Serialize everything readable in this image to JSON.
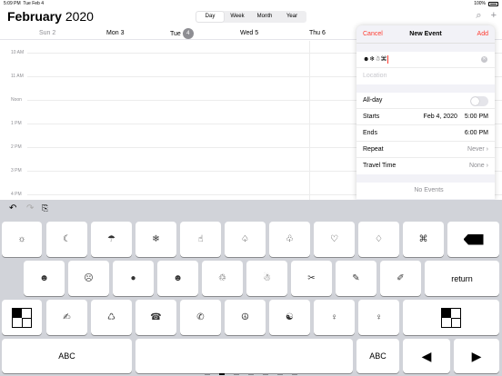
{
  "status": {
    "time": "5:09 PM",
    "date": "Tue Feb 4",
    "battery": "100%"
  },
  "header": {
    "month": "February",
    "year": "2020",
    "views": [
      "Day",
      "Week",
      "Month",
      "Year"
    ],
    "active_view": "Day"
  },
  "days": [
    {
      "name": "Sun",
      "num": "2"
    },
    {
      "name": "Mon",
      "num": "3"
    },
    {
      "name": "Tue",
      "num": "4"
    },
    {
      "name": "Wed",
      "num": "5"
    },
    {
      "name": "Thu",
      "num": "6"
    }
  ],
  "hours": [
    "10 AM",
    "11 AM",
    "Noon",
    "1 PM",
    "2 PM",
    "3 PM",
    "4 PM"
  ],
  "new_event": {
    "cancel": "Cancel",
    "title": "New Event",
    "add": "Add",
    "title_value": "☻❄☃⌘",
    "location_placeholder": "Location",
    "allday_label": "All-day",
    "starts_label": "Starts",
    "starts_date": "Feb 4, 2020",
    "starts_time": "5:00 PM",
    "ends_label": "Ends",
    "ends_time": "6:00 PM",
    "repeat_label": "Repeat",
    "repeat_value": "Never",
    "travel_label": "Travel Time",
    "travel_value": "None",
    "no_events": "No Events"
  },
  "keyboard": {
    "row1": [
      "☼",
      "☾",
      "☂",
      "❄",
      "☝",
      "♤",
      "♧",
      "♡",
      "♢",
      "⌘"
    ],
    "row2": [
      "☻",
      "☹",
      "●",
      "☻",
      "♲",
      "☃",
      "✂",
      "✎",
      "✐"
    ],
    "row3": [
      "✍",
      "♺",
      "☎",
      "✆",
      "☮",
      "☯",
      "♀",
      "♀"
    ],
    "return_label": "return",
    "abc_label": "ABC"
  }
}
